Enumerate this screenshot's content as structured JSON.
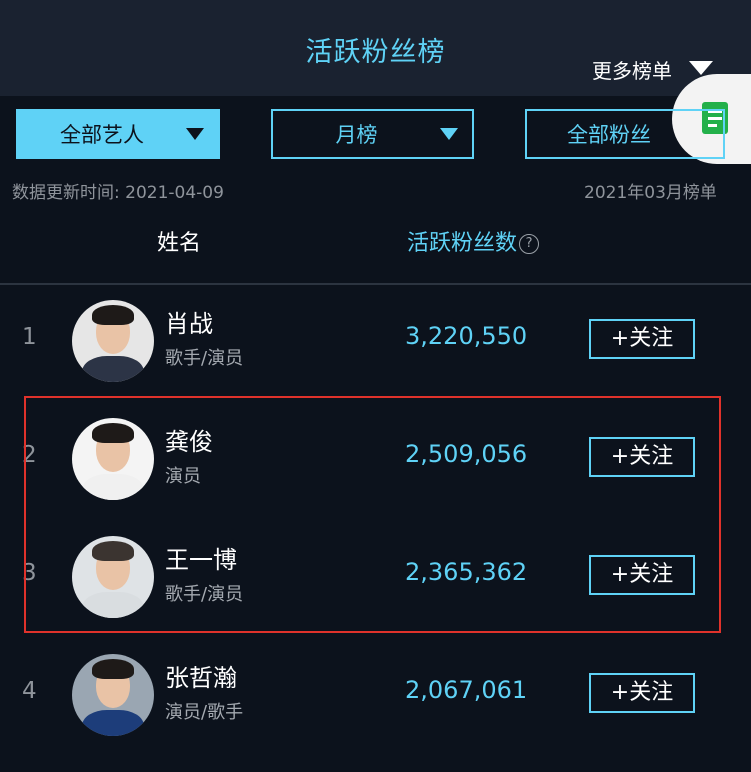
{
  "header": {
    "title": "活跃粉丝榜",
    "more_label": "更多榜单"
  },
  "side_tab": {
    "icon": "document-icon"
  },
  "filters": [
    {
      "label": "全部艺人",
      "selected": true
    },
    {
      "label": "月榜",
      "selected": false
    },
    {
      "label": "全部粉丝",
      "selected": false
    }
  ],
  "meta": {
    "updated": "数据更新时间: 2021-04-09",
    "period": "2021年03月榜单"
  },
  "columns": {
    "name": "姓名",
    "fans": "活跃粉丝数",
    "help_icon": "?"
  },
  "rows": [
    {
      "rank": "1",
      "name": "肖战",
      "role": "歌手/演员",
      "fans": "3,220,550",
      "follow": "+关注"
    },
    {
      "rank": "2",
      "name": "龚俊",
      "role": "演员",
      "fans": "2,509,056",
      "follow": "+关注"
    },
    {
      "rank": "3",
      "name": "王一博",
      "role": "歌手/演员",
      "fans": "2,365,362",
      "follow": "+关注"
    },
    {
      "rank": "4",
      "name": "张哲瀚",
      "role": "演员/歌手",
      "fans": "2,067,061",
      "follow": "+关注"
    }
  ],
  "colors": {
    "accent": "#5fd2f6",
    "background": "#0c121c",
    "highlight": "#e0322b"
  }
}
